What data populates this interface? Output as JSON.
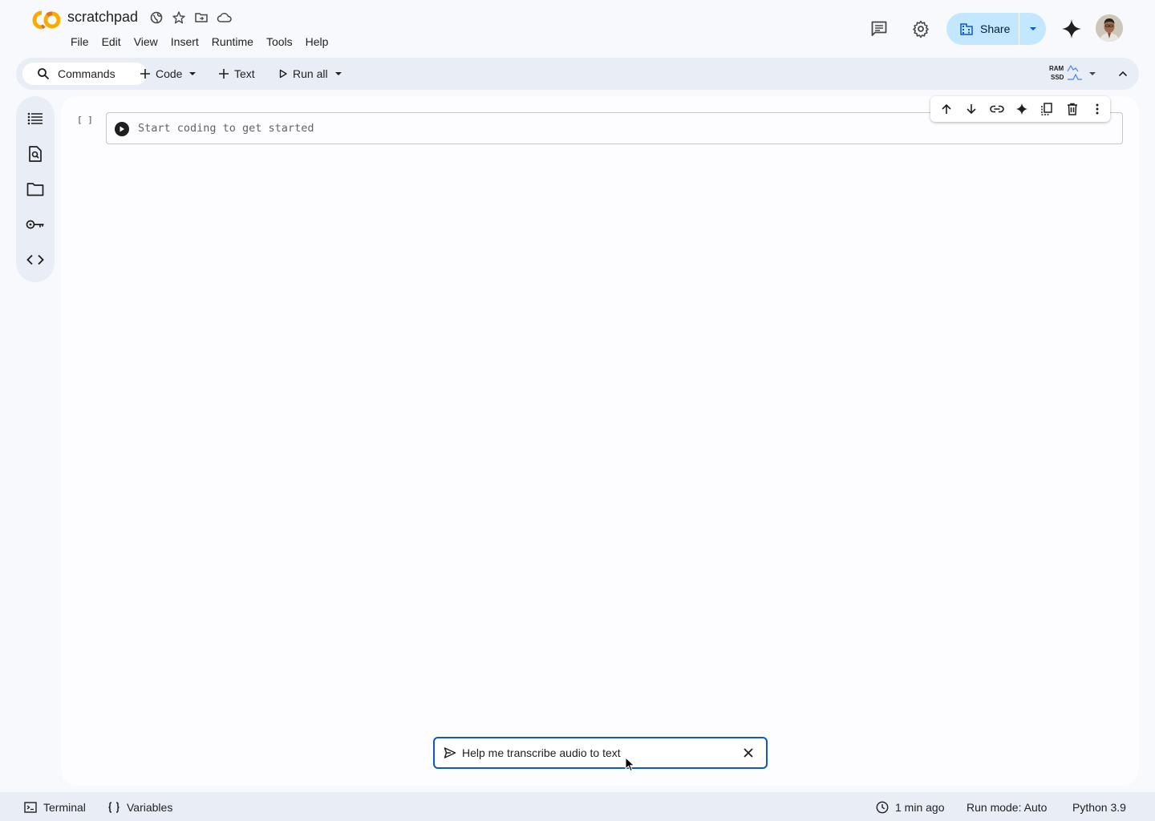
{
  "app": {
    "title": "scratchpad",
    "title_icons": [
      "globe-icon",
      "star-icon",
      "move-folder-icon",
      "cloud-icon"
    ],
    "menu": [
      "File",
      "Edit",
      "View",
      "Insert",
      "Runtime",
      "Tools",
      "Help"
    ],
    "share_label": "Share",
    "colors": {
      "accent": "#0b57d0",
      "share_bg": "#c2e7ff",
      "logo_orange": "#f9ab00",
      "logo_dark_orange": "#e8710a"
    }
  },
  "toolbar": {
    "commands_label": "Commands",
    "code_label": "Code",
    "text_label": "Text",
    "run_all_label": "Run all",
    "ram_label": "RAM",
    "ssd_label": "SSD"
  },
  "rail": {
    "items": [
      "table-of-contents-icon",
      "find-replace-icon",
      "files-folder-icon",
      "secrets-key-icon",
      "code-snippets-icon"
    ]
  },
  "cell": {
    "bracket": "[ ]",
    "placeholder": "Start coding to get started",
    "tools": [
      "move-up-icon",
      "move-down-icon",
      "link-icon",
      "gemini-spark-icon",
      "mirror-cell-icon",
      "delete-icon",
      "more-vert-icon"
    ]
  },
  "prompt": {
    "text": "Help me transcribe audio to text"
  },
  "status": {
    "terminal_label": "Terminal",
    "variables_label": "Variables",
    "last_saved": "1 min ago",
    "run_mode": "Run mode: Auto",
    "python_version": "Python 3.9"
  }
}
